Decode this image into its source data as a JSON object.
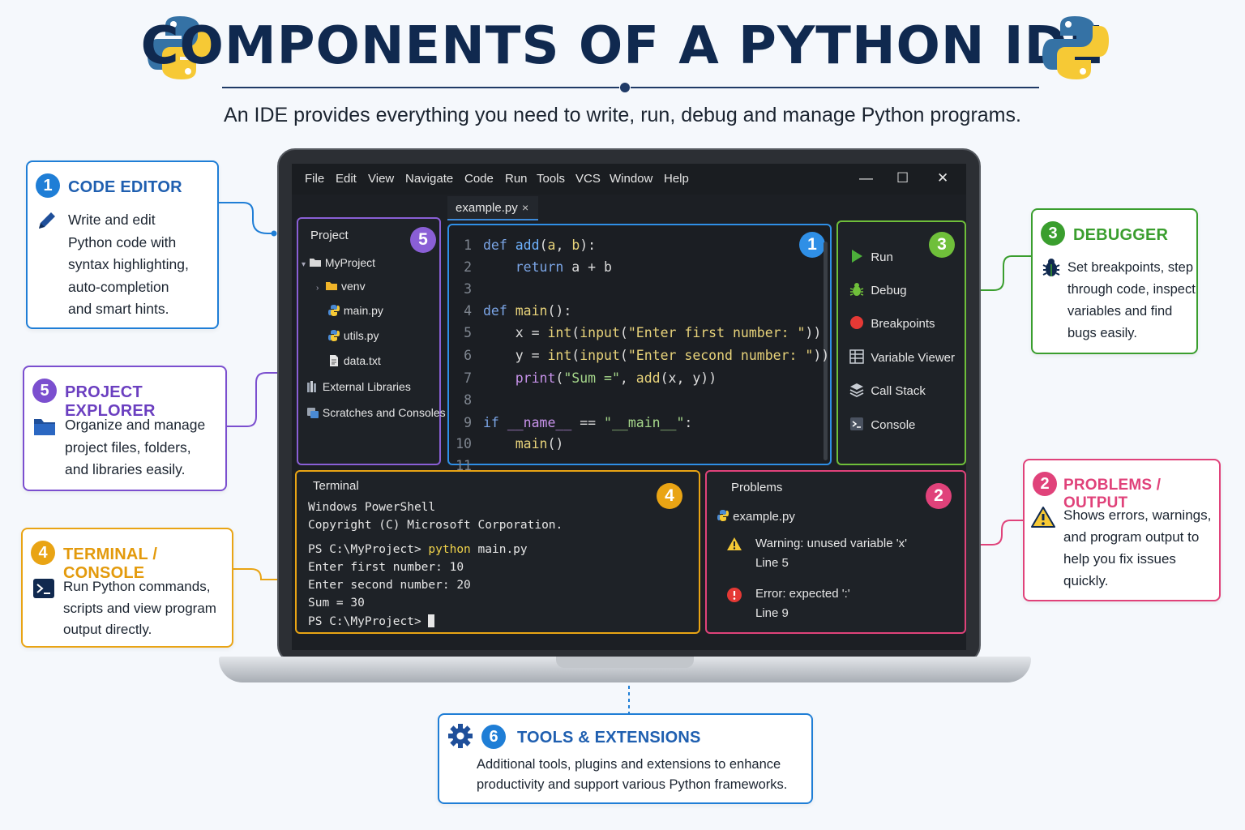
{
  "header": {
    "title": "COMPONENTS OF A PYTHON IDE",
    "subtitle": "An IDE provides everything you need to write, run, debug and manage Python programs."
  },
  "colors": {
    "blue": "#1f7ed6",
    "purple": "#7b4fcf",
    "green": "#3a9e2e",
    "orange": "#e9a414",
    "pink": "#e0427a",
    "navy": "#10294f"
  },
  "callouts": {
    "code_editor": {
      "number": "1",
      "title": "CODE EDITOR",
      "lines": [
        "Write and edit",
        "Python code with",
        "syntax highlighting,",
        "auto-completion",
        "and smart hints."
      ],
      "icon": "pencil-icon"
    },
    "project_explorer": {
      "number": "5",
      "title": "PROJECT EXPLORER",
      "lines": [
        "Organize and manage",
        "project files, folders,",
        "and libraries easily."
      ],
      "icon": "folder-icon"
    },
    "terminal": {
      "number": "4",
      "title": "TERMINAL / CONSOLE",
      "lines": [
        "Run Python commands,",
        "scripts and view program",
        "output directly."
      ],
      "icon": "terminal-icon"
    },
    "debugger": {
      "number": "3",
      "title": "DEBUGGER",
      "lines": [
        "Set breakpoints, step",
        "through code, inspect",
        "variables and find",
        "bugs easily."
      ],
      "icon": "bug-icon"
    },
    "problems": {
      "number": "2",
      "title": "PROBLEMS / OUTPUT",
      "lines": [
        "Shows errors, warnings,",
        "and program output to",
        "help you fix issues",
        "quickly."
      ],
      "icon": "warning-icon"
    },
    "tools": {
      "number": "6",
      "title": "TOOLS & EXTENSIONS",
      "lines": [
        "Additional tools, plugins and extensions to enhance",
        "productivity and support various Python frameworks."
      ],
      "icon": "gear-icon"
    }
  },
  "ide": {
    "menu": [
      "File",
      "Edit",
      "View",
      "Navigate",
      "Code",
      "Run",
      "Tools",
      "VCS",
      "Window",
      "Help"
    ],
    "window_buttons": [
      "—",
      "☐",
      "✕"
    ],
    "tab": {
      "label": "example.py",
      "close": "×"
    },
    "project": {
      "header": "Project",
      "badge": "5",
      "items": [
        "MyProject",
        "venv",
        "main.py",
        "utils.py",
        "data.txt",
        "External Libraries",
        "Scratches and Consoles"
      ]
    },
    "editor": {
      "badge": "1",
      "line_numbers": [
        "1",
        "2",
        "3",
        "4",
        "5",
        "6",
        "7",
        "8",
        "9",
        "10",
        "11"
      ]
    },
    "debugger": {
      "badge": "3",
      "items": [
        "Run",
        "Debug",
        "Breakpoints",
        "Variable Viewer",
        "Call Stack",
        "Console"
      ]
    },
    "terminal": {
      "header": "Terminal",
      "badge": "4",
      "lines": [
        "Windows PowerShell",
        "Copyright (C) Microsoft Corporation.",
        "",
        "PS C:\\MyProject> ",
        "Enter first number: 10",
        "Enter second number: 20",
        "Sum = 30",
        "PS C:\\MyProject> "
      ],
      "command": "python",
      "command_arg": " main.py"
    },
    "problems": {
      "header": "Problems",
      "badge": "2",
      "file": "example.py",
      "warning": "Warning: unused variable 'x'",
      "warning_line": "Line 5",
      "error": "Error: expected ':'",
      "error_line": "Line 9"
    }
  }
}
